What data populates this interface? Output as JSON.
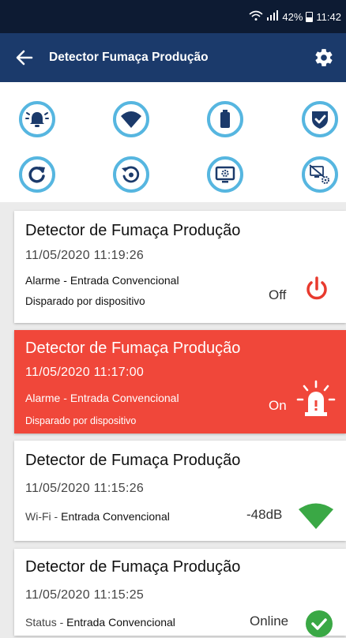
{
  "status_bar": {
    "battery": "42%",
    "time": "11:42",
    "wifi_icon": "wifi-question-icon",
    "signal_icon": "signal-bars-icon"
  },
  "app_bar": {
    "title": "Detector Fumaça Produção",
    "back_icon": "arrow-left-icon",
    "settings_icon": "gear-icon"
  },
  "action_icons": [
    {
      "name": "alarm-icon"
    },
    {
      "name": "wifi-icon"
    },
    {
      "name": "battery-icon"
    },
    {
      "name": "shield-check-icon"
    },
    {
      "name": "refresh-icon"
    },
    {
      "name": "history-icon"
    },
    {
      "name": "monitor-settings-icon"
    },
    {
      "name": "monitor-off-settings-icon"
    }
  ],
  "events": [
    {
      "device": "Detector de Fumaça Produção",
      "timestamp": "11/05/2020  11:19:26",
      "event_type": "Alarme",
      "event_sep": " - ",
      "event_source": "Entrada Convencional",
      "detail": "Disparado por dispositivo",
      "value": "Off",
      "icon": "power-icon",
      "icon_color": "#e83a2e",
      "highlight": false
    },
    {
      "device": "Detector de Fumaça Produção",
      "timestamp": "11/05/2020  11:17:00",
      "event_type": "Alarme",
      "event_sep": " - ",
      "event_source": "Entrada Convencional",
      "detail": "Disparado por dispositivo",
      "value": "On",
      "icon": "siren-icon",
      "icon_color": "#ffffff",
      "highlight": true,
      "highlight_color": "#f0473a"
    },
    {
      "device": "Detector de Fumaça Produção",
      "timestamp": "11/05/2020  11:15:26",
      "event_type": "Wi-Fi",
      "event_sep": " - ",
      "event_source": "Entrada Convencional",
      "value": "-48dB",
      "icon": "wifi-signal-icon",
      "icon_color": "#3aa845",
      "highlight": false
    },
    {
      "device": "Detector de Fumaça Produção",
      "timestamp": "11/05/2020  11:15:25",
      "event_type": "Status",
      "event_sep": " - ",
      "event_source": "Entrada Convencional",
      "value": "Online",
      "icon": "check-circle-icon",
      "icon_color": "#3aa845",
      "highlight": false
    }
  ],
  "colors": {
    "status_bar": "#0d1b33",
    "app_bar": "#1b3a6b",
    "icon_ring": "#56b6e0",
    "icon_fill": "#1b3a6b"
  }
}
